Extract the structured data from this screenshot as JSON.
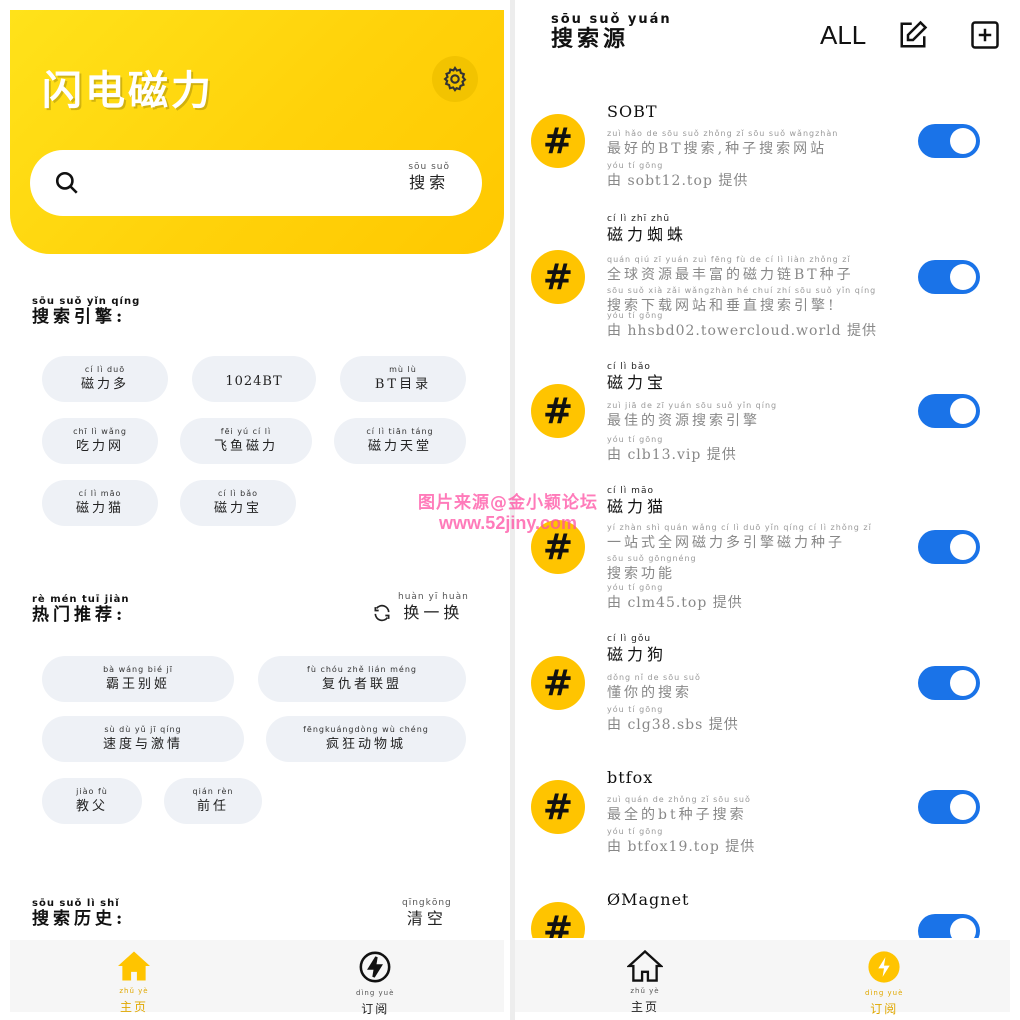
{
  "left": {
    "app_title": "闪电磁力",
    "search": {
      "label_py": "sōu suǒ",
      "label": "搜索"
    },
    "engines_section": {
      "title_py": "sōu suǒ yǐn qíng",
      "title": "搜索引擎:"
    },
    "engines": [
      {
        "py": "cí lì duō",
        "label": "磁力多"
      },
      {
        "py": "",
        "label": "1024BT"
      },
      {
        "py": "mù lù",
        "label": "BT目录"
      },
      {
        "py": "chī lì wǎng",
        "label": "吃力网"
      },
      {
        "py": "fēi yú cí lì",
        "label": "飞鱼磁力"
      },
      {
        "py": "cí lì tiān táng",
        "label": "磁力天堂"
      },
      {
        "py": "cí lì māo",
        "label": "磁力猫"
      },
      {
        "py": "cí lì bǎo",
        "label": "磁力宝"
      }
    ],
    "hot_section": {
      "title_py": "rè mén tuī jiàn",
      "title": "热门推荐:",
      "swap_py": "huàn yī huàn",
      "swap": "换一换"
    },
    "hot": [
      {
        "py": "bà wáng bié jī",
        "label": "霸王别姬"
      },
      {
        "py": "fù chóu zhě lián méng",
        "label": "复仇者联盟"
      },
      {
        "py": "sù dù yǔ jī qíng",
        "label": "速度与激情"
      },
      {
        "py": "fēngkuángdòng wù chéng",
        "label": "疯狂动物城"
      },
      {
        "py": "jiào fù",
        "label": "教父"
      },
      {
        "py": "qián rèn",
        "label": "前任"
      }
    ],
    "history_section": {
      "title_py": "sōu suǒ lì shǐ",
      "title": "搜索历史:",
      "clear_py": "qīngkōng",
      "clear": "清空"
    },
    "tabs": [
      {
        "py": "zhǔ yè",
        "label": "主页"
      },
      {
        "py": "dìng yuè",
        "label": "订阅"
      }
    ]
  },
  "right": {
    "title_py": "sōu suǒ yuán",
    "title": "搜索源",
    "all_label": "ALL",
    "engines": [
      {
        "name_py": "",
        "name": "SOBT",
        "desc_py": "zuì hǎo de sōu suǒ zhǒng zǐ sōu suǒ wǎngzhàn",
        "desc": "最好的BT搜索,种子搜索网站",
        "src_py": "yóu tí gōng",
        "src": "由 sobt12.top 提供",
        "enabled": true
      },
      {
        "name_py": "cí lì zhī zhū",
        "name": "磁力蜘蛛",
        "desc_py": "quán qiú zī yuán zuì fēng fù de cí lì liàn zhǒng zǐ",
        "desc": "全球资源最丰富的磁力链BT种子",
        "desc2_py": "sōu suǒ xià zǎi wǎngzhàn hé chuí zhí sōu suǒ yǐn qíng",
        "desc2": "搜索下载网站和垂直搜索引擎!",
        "src_py": "yóu tí gōng",
        "src": "由 hhsbd02.towercloud.world 提供",
        "enabled": true
      },
      {
        "name_py": "cí lì bǎo",
        "name": "磁力宝",
        "desc_py": "zuì jiā de zī yuán sōu suǒ yǐn qíng",
        "desc": "最佳的资源搜索引擎",
        "src_py": "yóu tí gōng",
        "src": "由 clb13.vip 提供",
        "enabled": true
      },
      {
        "name_py": "cí lì māo",
        "name": "磁力猫",
        "desc_py": "yí zhàn shì quán wǎng cí lì duō yǐn qíng cí lì zhǒng zǐ",
        "desc": "一站式全网磁力多引擎磁力种子",
        "desc2_py": "sōu suǒ gōngnéng",
        "desc2": "搜索功能",
        "src_py": "yóu tí gōng",
        "src": "由 clm45.top 提供",
        "enabled": true
      },
      {
        "name_py": "cí lì gǒu",
        "name": "磁力狗",
        "desc_py": "dǒng nǐ de sōu suǒ",
        "desc": "懂你的搜索",
        "src_py": "yóu tí gōng",
        "src": "由 clg38.sbs 提供",
        "enabled": true
      },
      {
        "name_py": "",
        "name": "btfox",
        "desc_py": "zuì quán de zhǒng zǐ sōu suǒ",
        "desc": "最全的bt种子搜索",
        "src_py": "yóu tí gōng",
        "src": "由 btfox19.top 提供",
        "enabled": true
      },
      {
        "name_py": "",
        "name": "ØMagnet",
        "enabled": true
      }
    ],
    "tabs": [
      {
        "py": "zhǔ yè",
        "label": "主页"
      },
      {
        "py": "dìng yuè",
        "label": "订阅"
      }
    ]
  },
  "watermark": {
    "line1": "图片来源@金小颖论坛",
    "line2": "www.52jiny.com"
  },
  "colors": {
    "brand_yellow": "#ffd20a",
    "toggle_blue": "#1a73e8",
    "chip_bg": "#eef1f6"
  }
}
